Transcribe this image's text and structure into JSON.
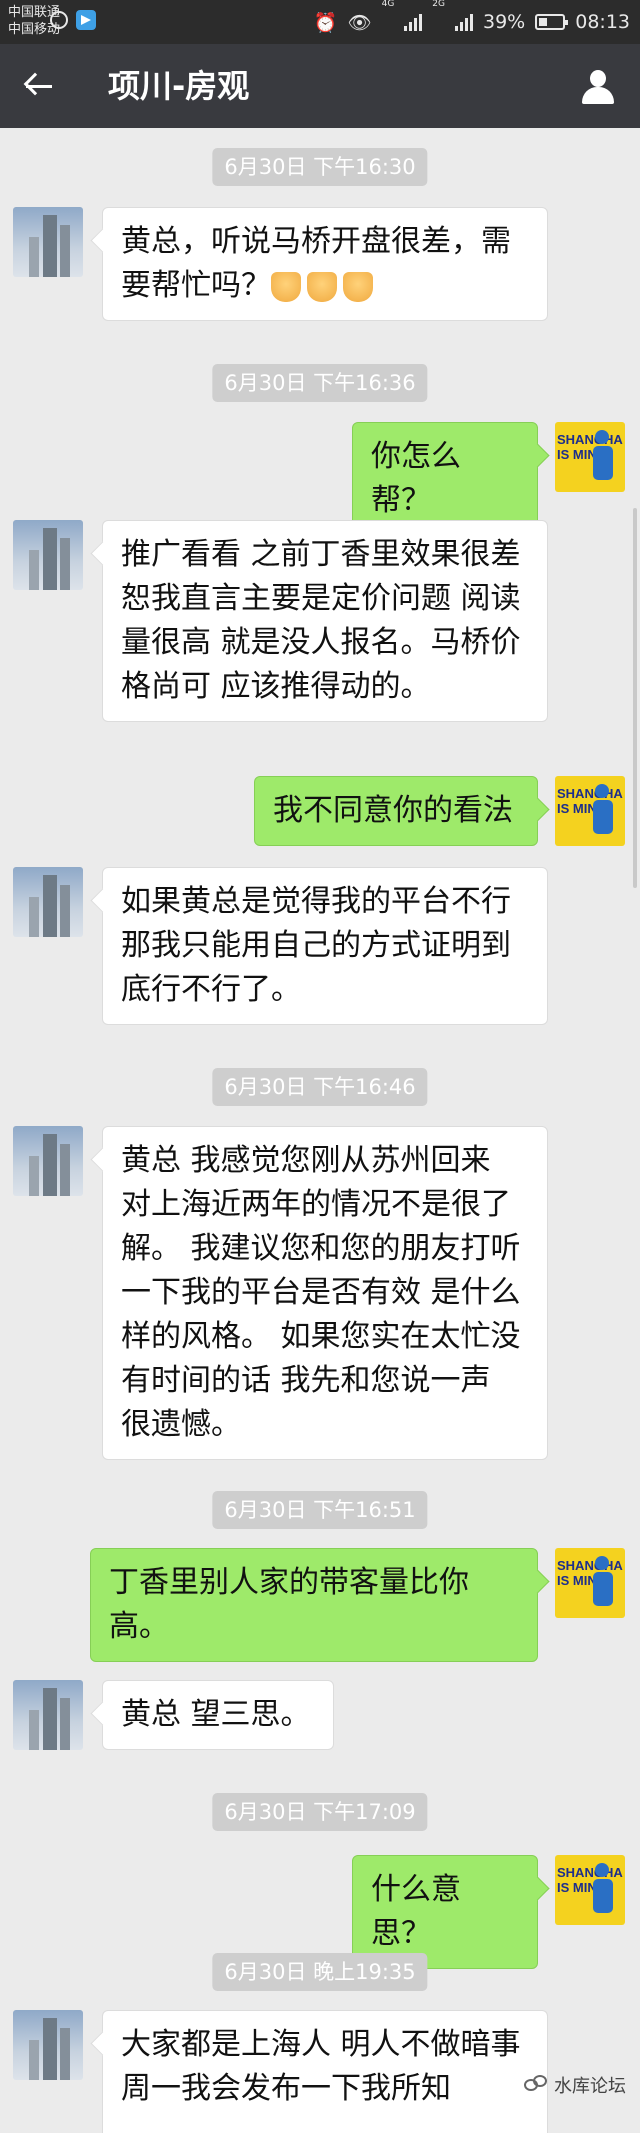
{
  "status_bar": {
    "carrier1": "中国联通",
    "carrier2": "中国移动",
    "net1": "4G",
    "net2": "2G",
    "battery": "39%",
    "time": "08:13"
  },
  "header": {
    "title": "项川-房观",
    "back_icon": "arrow-left-icon",
    "profile_icon": "person-icon"
  },
  "messages": [
    {
      "kind": "time",
      "text": "6月30日 下午16:30"
    },
    {
      "kind": "in",
      "text": "黄总，听说马桥开盘很差，需要帮忙吗？",
      "emoji": "folded-hands"
    },
    {
      "kind": "time",
      "text": "6月30日 下午16:36"
    },
    {
      "kind": "out",
      "text": "你怎么帮？"
    },
    {
      "kind": "in",
      "text": "推广看看 之前丁香里效果很差 恕我直言主要是定价问题 阅读量很高 就是没人报名。马桥价格尚可 应该推得动的。"
    },
    {
      "kind": "out",
      "text": "我不同意你的看法"
    },
    {
      "kind": "in",
      "text": "如果黄总是觉得我的平台不行 那我只能用自己的方式证明到底行不行了。"
    },
    {
      "kind": "time",
      "text": "6月30日 下午16:46"
    },
    {
      "kind": "in",
      "text": "黄总 我感觉您刚从苏州回来 对上海近两年的情况不是很了解。 我建议您和您的朋友打听一下我的平台是否有效 是什么样的风格。 如果您实在太忙没有时间的话 我先和您说一声 很遗憾。"
    },
    {
      "kind": "time",
      "text": "6月30日 下午16:51"
    },
    {
      "kind": "out",
      "text": "丁香里别人家的带客量比你高。"
    },
    {
      "kind": "in",
      "text": "黄总 望三思。"
    },
    {
      "kind": "time",
      "text": "6月30日 下午17:09"
    },
    {
      "kind": "out",
      "text": "什么意思？"
    },
    {
      "kind": "time",
      "text": "6月30日 晚上19:35"
    },
    {
      "kind": "in",
      "text": "大家都是上海人 明人不做暗事 周一我会发布一下我所知"
    }
  ],
  "avatar_right_text": "SHANGHA\nIS MINE",
  "watermark": "水库论坛"
}
